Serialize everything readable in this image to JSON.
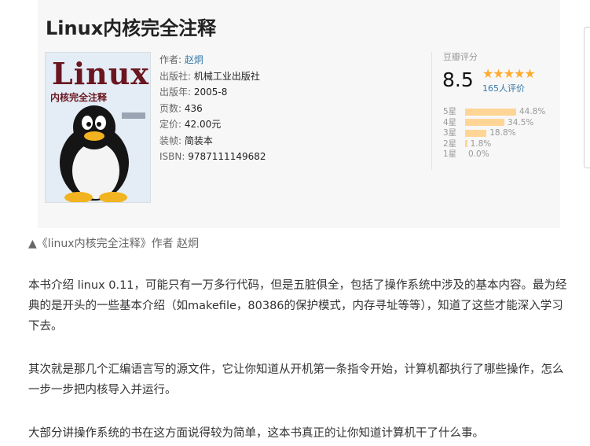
{
  "book": {
    "title": "Linux内核完全注释",
    "cover": {
      "title": "Linux",
      "subtitle": "内核完全注释"
    },
    "meta": [
      {
        "label": "作者:",
        "value": "赵炯",
        "is_link": true
      },
      {
        "label": "出版社:",
        "value": "机械工业出版社",
        "is_link": false
      },
      {
        "label": "出版年:",
        "value": "2005-8",
        "is_link": false
      },
      {
        "label": "页数:",
        "value": "436",
        "is_link": false
      },
      {
        "label": "定价:",
        "value": "42.00元",
        "is_link": false
      },
      {
        "label": "装帧:",
        "value": "简装本",
        "is_link": false
      },
      {
        "label": "ISBN:",
        "value": "9787111149682",
        "is_link": false
      }
    ]
  },
  "rating": {
    "label": "豆瓣评分",
    "score": "8.5",
    "stars": "★★★★★",
    "count_text": "165人评价",
    "distribution": [
      {
        "star": "5星",
        "pct": "44.8%",
        "value": 44.8
      },
      {
        "star": "4星",
        "pct": "34.5%",
        "value": 34.5
      },
      {
        "star": "3星",
        "pct": "18.8%",
        "value": 18.8
      },
      {
        "star": "2星",
        "pct": "1.8%",
        "value": 1.8
      },
      {
        "star": "1星",
        "pct": "0.0%",
        "value": 0.0
      }
    ]
  },
  "caption": "▲《linux内核完全注释》作者 赵炯",
  "paragraphs": [
    "本书介绍 linux 0.11，可能只有一万多行代码，但是五脏俱全，包括了操作系统中涉及的基本内容。最为经典的是开头的一些基本介绍（如makefile，80386的保护模式，内存寻址等等），知道了这些才能深入学习下去。",
    "其次就是那几个汇编语言写的源文件，它让你知道从开机第一条指令开始，计算机都执行了哪些操作，怎么一步一步把内核导入并运行。",
    "大部分讲操作系统的书在这方面说得较为简单，这本书真正的让你知道计算机干了什么事。"
  ],
  "colors": {
    "link": "#3377aa",
    "star": "#ffac2d",
    "bar": "#ffd596",
    "cover_title": "#6a1620"
  }
}
